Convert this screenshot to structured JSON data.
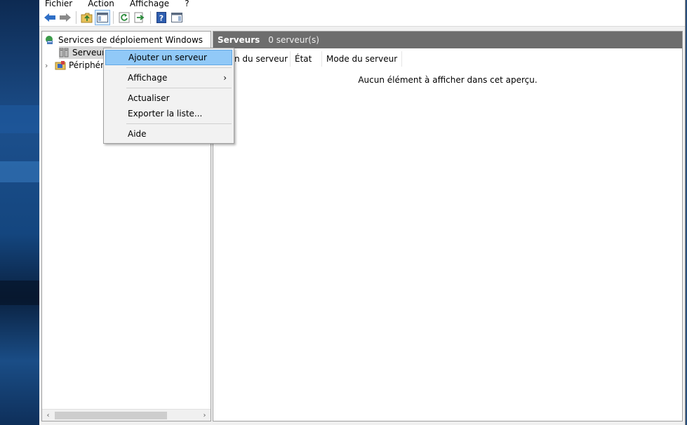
{
  "menubar": {
    "items": [
      "Fichier",
      "Action",
      "Affichage",
      "?"
    ]
  },
  "toolbar": {
    "buttons": [
      "back-arrow-icon",
      "forward-arrow-icon",
      "folder-up-icon",
      "show-hide-tree-icon",
      "refresh-icon",
      "export-list-icon",
      "help-icon",
      "properties-pane-icon"
    ]
  },
  "tree": {
    "root_label": "Services de déploiement Windows",
    "child1_label": "Serveurs",
    "child2_label": "Périphér"
  },
  "content": {
    "title": "Serveurs",
    "count": "0 serveur(s)",
    "columns": [
      "n du serveur",
      "État",
      "Mode du serveur"
    ],
    "empty_message": "Aucun élément à afficher dans cet aperçu."
  },
  "context_menu": {
    "items": [
      "Ajouter un serveur",
      "Affichage",
      "Actualiser",
      "Exporter la liste...",
      "Aide"
    ],
    "submenu_arrow": "›"
  },
  "colors": {
    "header_bg": "#6d6d6d",
    "highlight_bg": "#91c9f7",
    "toolbar_blue": "#2f6fc6"
  }
}
